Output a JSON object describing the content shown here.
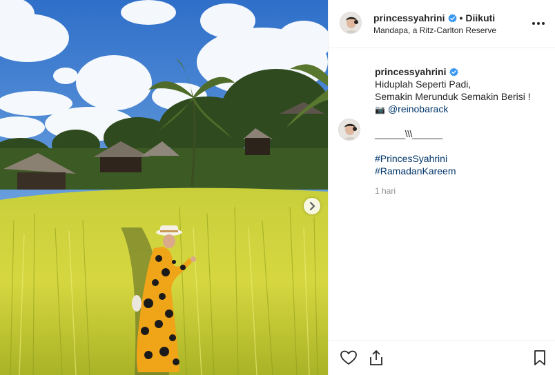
{
  "post": {
    "username": "princessyahrini",
    "separator": "•",
    "follow_status": "Diikuti",
    "location": "Mandapa, a Ritz-Carlton Reserve",
    "caption_lines": [
      "Hiduplah Seperti Padi,",
      "Semakin Merunduk Semakin Berisi !"
    ],
    "photo_credit_icon": "camera-icon",
    "photo_credit_mention": "@reinobarack",
    "comment_text": "______\\\\\\______",
    "hashtags": [
      "#PrincesSyahrini",
      "#RamadanKareem"
    ],
    "time_ago": "1 hari"
  },
  "icons": {
    "verified": "verified-badge-icon",
    "more": "more-options-icon",
    "like": "heart-icon",
    "share": "share-icon",
    "save": "bookmark-icon",
    "next": "chevron-right-icon"
  },
  "colors": {
    "verified_blue": "#3897f0",
    "link_blue": "#003569",
    "muted_gray": "#8e8e8e",
    "border": "#efefef"
  }
}
